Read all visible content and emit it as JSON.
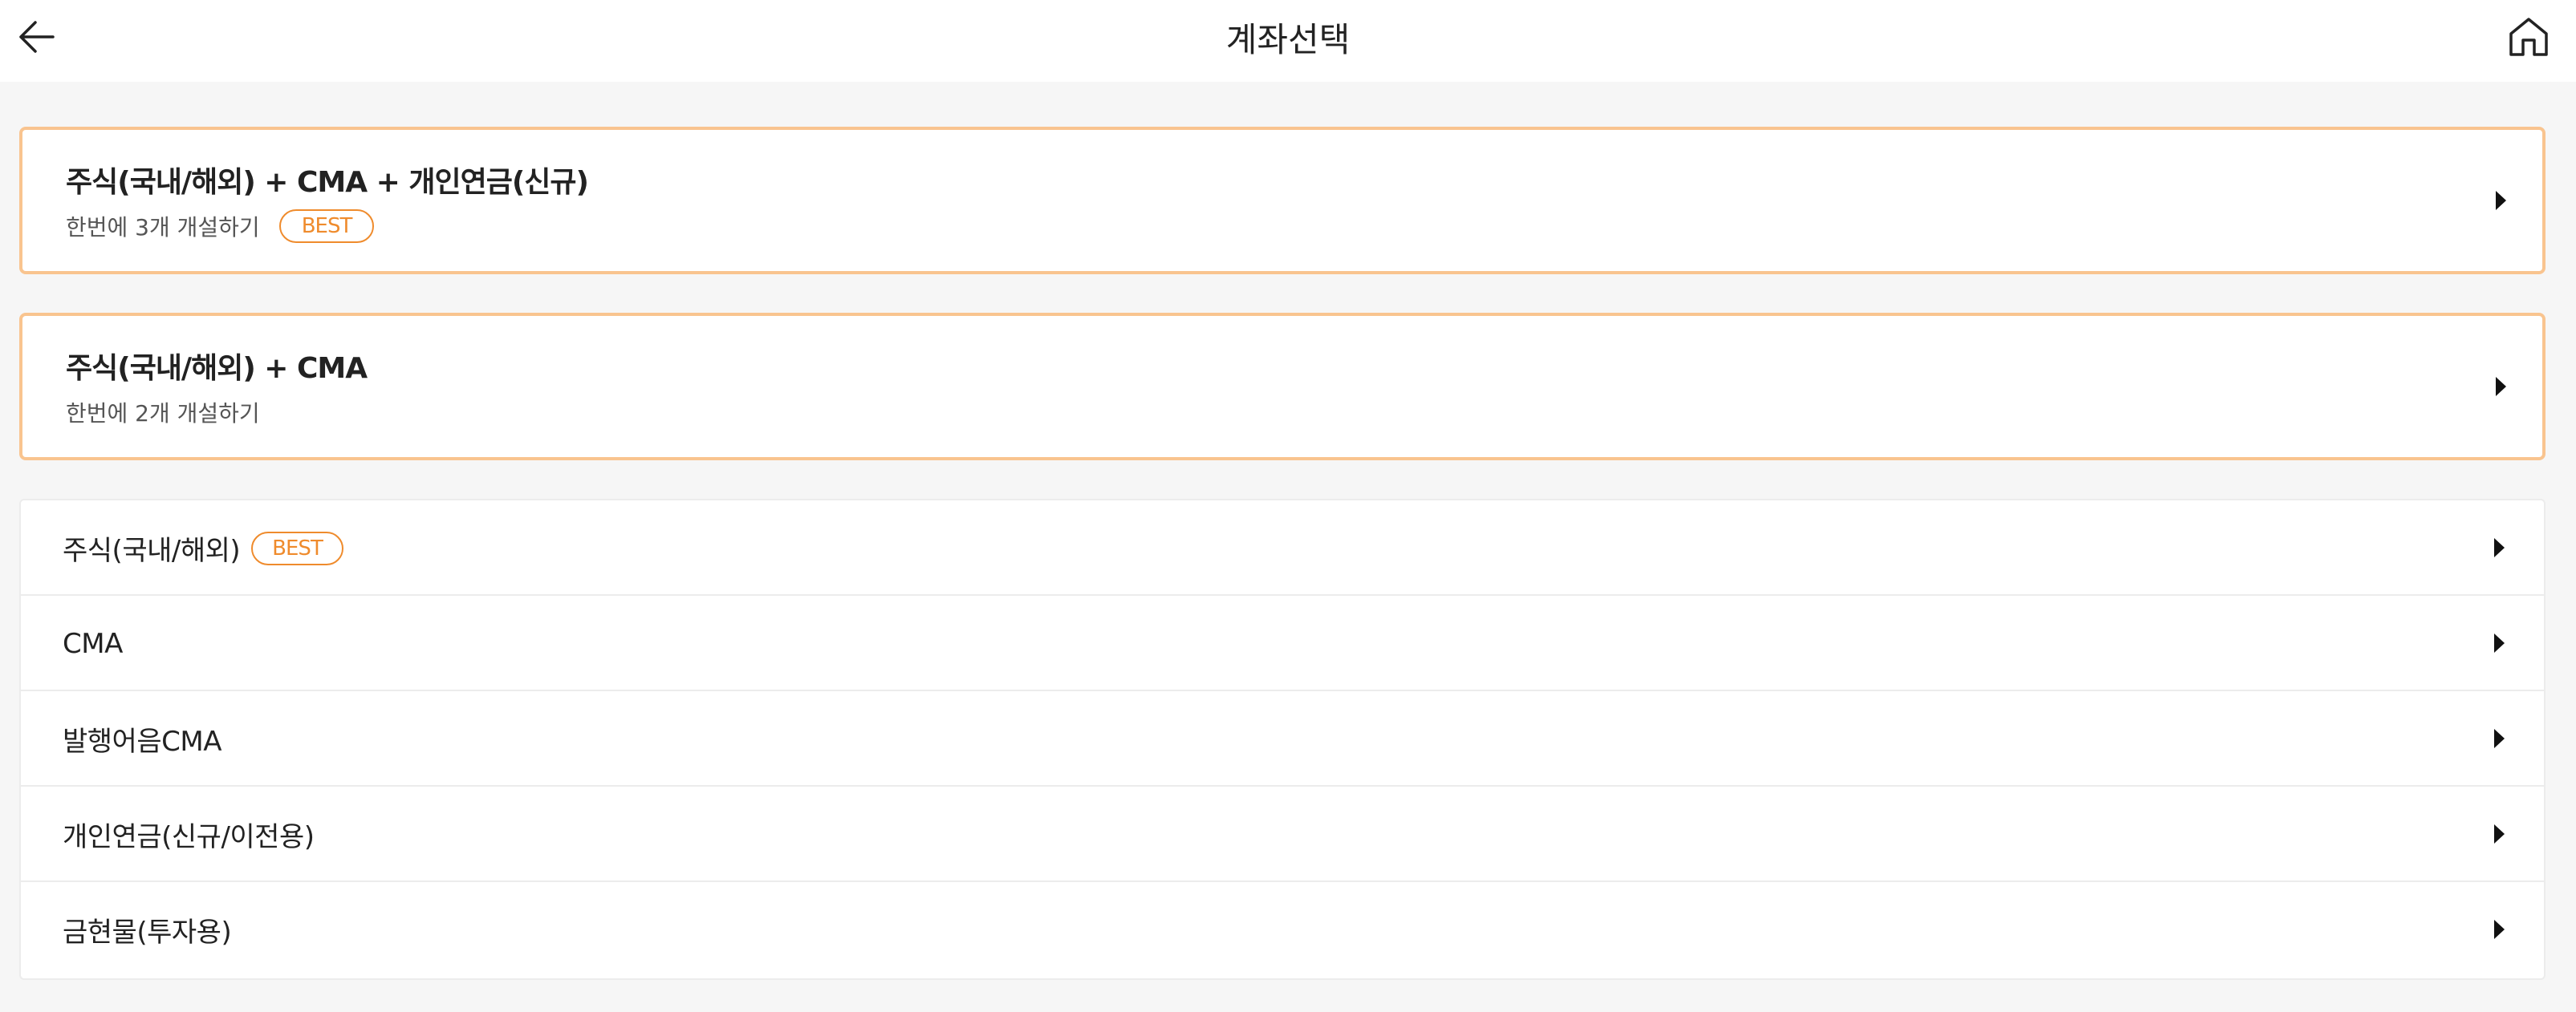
{
  "header": {
    "title": "계좌선택",
    "back_icon": "arrow-left-icon",
    "home_icon": "home-icon"
  },
  "colors": {
    "accent": "#ef8b2c",
    "card_border": "#f9c48f",
    "background": "#f6f6f6"
  },
  "featured": [
    {
      "title": "주식(국내/해외) + CMA + 개인연금(신규)",
      "subtitle": "한번에 3개 개설하기",
      "badge": "BEST"
    },
    {
      "title": "주식(국내/해외) + CMA",
      "subtitle": "한번에 2개 개설하기"
    }
  ],
  "accounts": [
    {
      "label": "주식(국내/해외)",
      "badge": "BEST"
    },
    {
      "label": "CMA"
    },
    {
      "label": "발행어음CMA"
    },
    {
      "label": "개인연금(신규/이전용)"
    },
    {
      "label": "금현물(투자용)"
    }
  ]
}
